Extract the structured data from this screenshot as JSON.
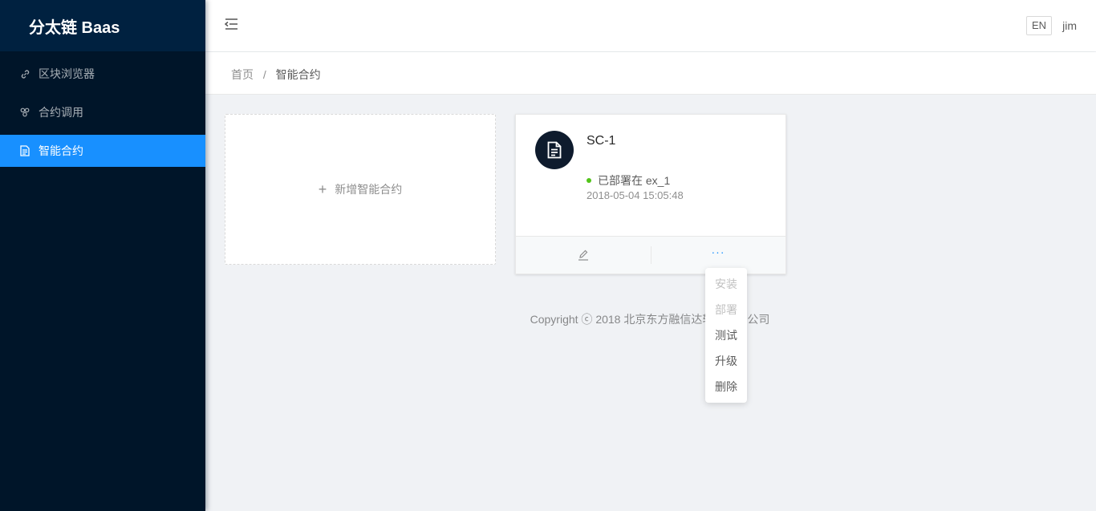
{
  "sidebar": {
    "logo": "分太链 Baas",
    "items": [
      {
        "label": "区块浏览器",
        "icon": "link-icon"
      },
      {
        "label": "合约调用",
        "icon": "cluster-icon"
      },
      {
        "label": "智能合约",
        "icon": "file-text-icon",
        "active": true
      }
    ]
  },
  "header": {
    "lang": "EN",
    "user": "jim"
  },
  "breadcrumb": {
    "home": "首页",
    "separator": "/",
    "current": "智能合约"
  },
  "new_card": {
    "plus": "+",
    "label": "新增智能合约"
  },
  "contract": {
    "name": "SC-1",
    "status": "已部署在 ex_1",
    "status_color": "#52c41a",
    "time": "2018-05-04 15:05:48",
    "more_label": "···"
  },
  "dropdown": {
    "items": [
      {
        "label": "安装",
        "disabled": true
      },
      {
        "label": "部署",
        "disabled": true
      },
      {
        "label": "测试",
        "disabled": false
      },
      {
        "label": "升级",
        "disabled": false
      },
      {
        "label": "删除",
        "disabled": false
      }
    ]
  },
  "footer": {
    "copyright": "Copyright ⓒ 2018 北京东方融信达软件有限公司"
  },
  "colors": {
    "sider_bg": "#001529",
    "primary": "#1890ff"
  }
}
